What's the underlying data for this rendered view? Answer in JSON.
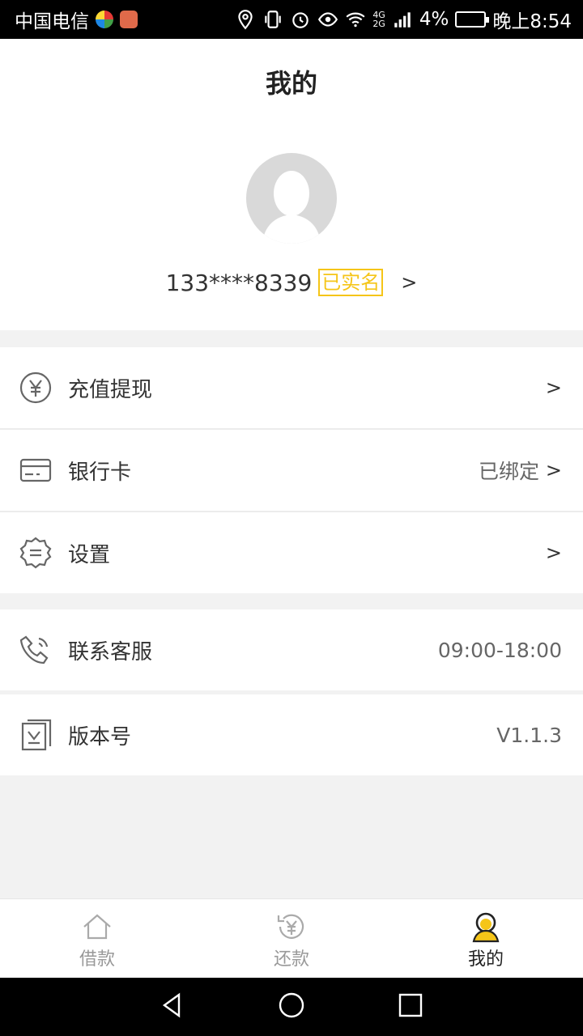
{
  "status_bar": {
    "carrier": "中国电信",
    "network_top": "4G",
    "network_bottom": "2G",
    "battery": "4%",
    "time": "晚上8:54"
  },
  "header": {
    "title": "我的",
    "phone": "133****8339",
    "verified_label": "已实名",
    "arrow": ">"
  },
  "menu": {
    "recharge": {
      "label": "充值提现",
      "arrow": ">"
    },
    "bank_card": {
      "label": "银行卡",
      "value": "已绑定",
      "arrow": ">"
    },
    "settings": {
      "label": "设置",
      "arrow": ">"
    },
    "customer_service": {
      "label": "联系客服",
      "value": "09:00-18:00"
    },
    "version": {
      "label": "版本号",
      "value": "V1.1.3"
    }
  },
  "tabs": [
    {
      "label": "借款",
      "icon": "home-icon",
      "active": false
    },
    {
      "label": "还款",
      "icon": "repay-icon",
      "active": false
    },
    {
      "label": "我的",
      "icon": "user-icon",
      "active": true
    }
  ],
  "colors": {
    "accent": "#f5c518",
    "icon_gray": "#666666",
    "background": "#f2f2f2"
  }
}
